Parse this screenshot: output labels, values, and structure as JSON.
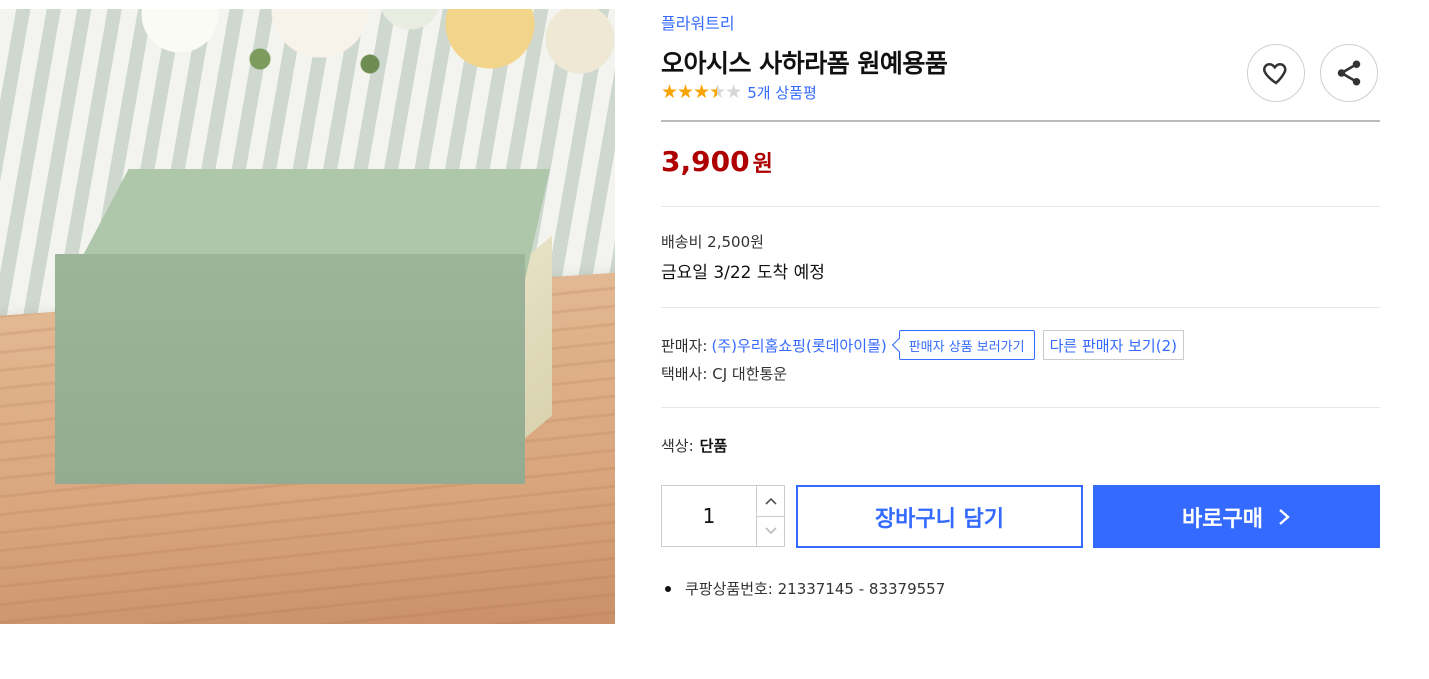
{
  "product": {
    "brand": "플라워트리",
    "title": "오아시스 사하라폼 원예용품",
    "rating_value": 3.5,
    "rating_max": 5,
    "review_text": "5개 상품평",
    "price_number": "3,900",
    "price_unit": "원",
    "shipping_fee": "배송비 2,500원",
    "arrival": "금요일 3/22 도착 예정",
    "seller_label": "판매자:",
    "seller_name": "(주)우리홈쇼핑(롯데아이몰)",
    "seller_products_button": "판매자 상품 보러가기",
    "other_sellers_button": "다른 판매자 보기(2)",
    "courier": "택배사: CJ 대한통운",
    "option_label": "색상:",
    "option_value": "단품",
    "quantity": "1",
    "cart_button": "장바구니 담기",
    "buy_button": "바로구매",
    "product_number": "쿠팡상품번호: 21337145 - 83379557"
  },
  "icons": {
    "like": "heart-icon",
    "share": "share-icon",
    "qty_up": "chevron-up-icon",
    "qty_down": "chevron-down-icon",
    "buy_arrow": "chevron-right-icon"
  },
  "colors": {
    "accent": "#346aff",
    "price": "#ae0000",
    "star": "#f8a404"
  }
}
